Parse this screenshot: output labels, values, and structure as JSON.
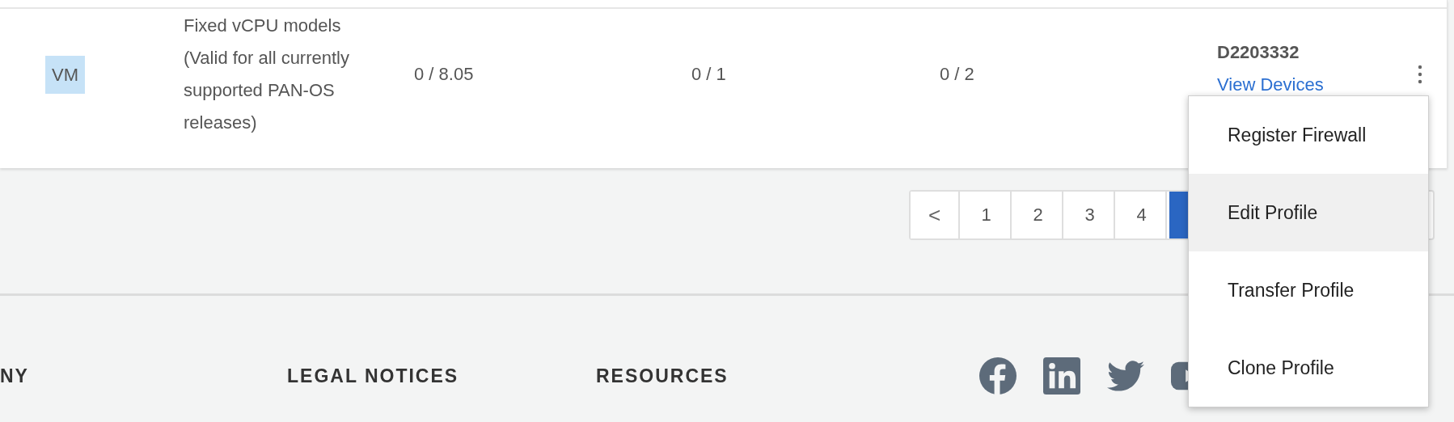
{
  "row": {
    "type_badge": "VM",
    "description": "Fixed vCPU models (Valid for all currently supported PAN-OS releases)",
    "column_3": "0 / 8.05",
    "column_4": "0 / 1",
    "column_5": "0 / 2",
    "auth_code": "D2203332",
    "link": "View Devices"
  },
  "pagination": [
    {
      "kind": "prev",
      "label": "<",
      "selected": false
    },
    {
      "kind": "page",
      "label": "1",
      "selected": false
    },
    {
      "kind": "page",
      "label": "2",
      "selected": false
    },
    {
      "kind": "page",
      "label": "3",
      "selected": false
    },
    {
      "kind": "page",
      "label": "4",
      "selected": false
    },
    {
      "kind": "page",
      "selected": true
    }
  ],
  "footer": {
    "headings": [
      "NY",
      "LEGAL NOTICES",
      "RESOURCES"
    ],
    "social": [
      {
        "kind": "facebook"
      },
      {
        "kind": "linkedin"
      },
      {
        "kind": "twitter"
      },
      {
        "kind": "youtube"
      }
    ]
  },
  "menu": [
    {
      "label": "Register Firewall",
      "highlighted": false
    },
    {
      "label": "Edit Profile",
      "highlighted": true
    },
    {
      "label": "Transfer Profile",
      "highlighted": false
    },
    {
      "label": "Clone Profile",
      "highlighted": false
    }
  ]
}
